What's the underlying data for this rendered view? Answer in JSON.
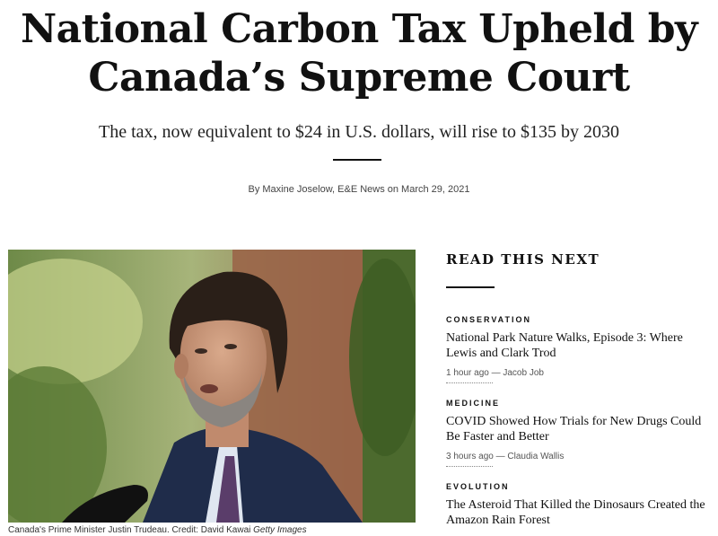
{
  "article": {
    "headline_line1": "National Carbon Tax Upheld by",
    "headline_line2": "Canada’s Supreme Court",
    "dek": "The tax, now equivalent to $24 in U.S. dollars, will rise to $135 by 2030",
    "byline": "By Maxine Joselow, E&E News on March 29, 2021"
  },
  "photo": {
    "caption_text": "Canada's Prime Minister Justin Trudeau. Credit: David Kawai ",
    "caption_credit": "Getty Images"
  },
  "sidebar": {
    "title": "READ THIS NEXT",
    "items": [
      {
        "category": "CONSERVATION",
        "title": "National Park Nature Walks, Episode 3: Where Lewis and Clark Trod",
        "meta": "1 hour ago — Jacob Job"
      },
      {
        "category": "MEDICINE",
        "title": "COVID Showed How Trials for New Drugs Could Be Faster and Better",
        "meta": "3 hours ago — Claudia Wallis"
      },
      {
        "category": "EVOLUTION",
        "title": "The Asteroid That Killed the Dinosaurs Created the Amazon Rain Forest",
        "meta": ""
      }
    ]
  }
}
